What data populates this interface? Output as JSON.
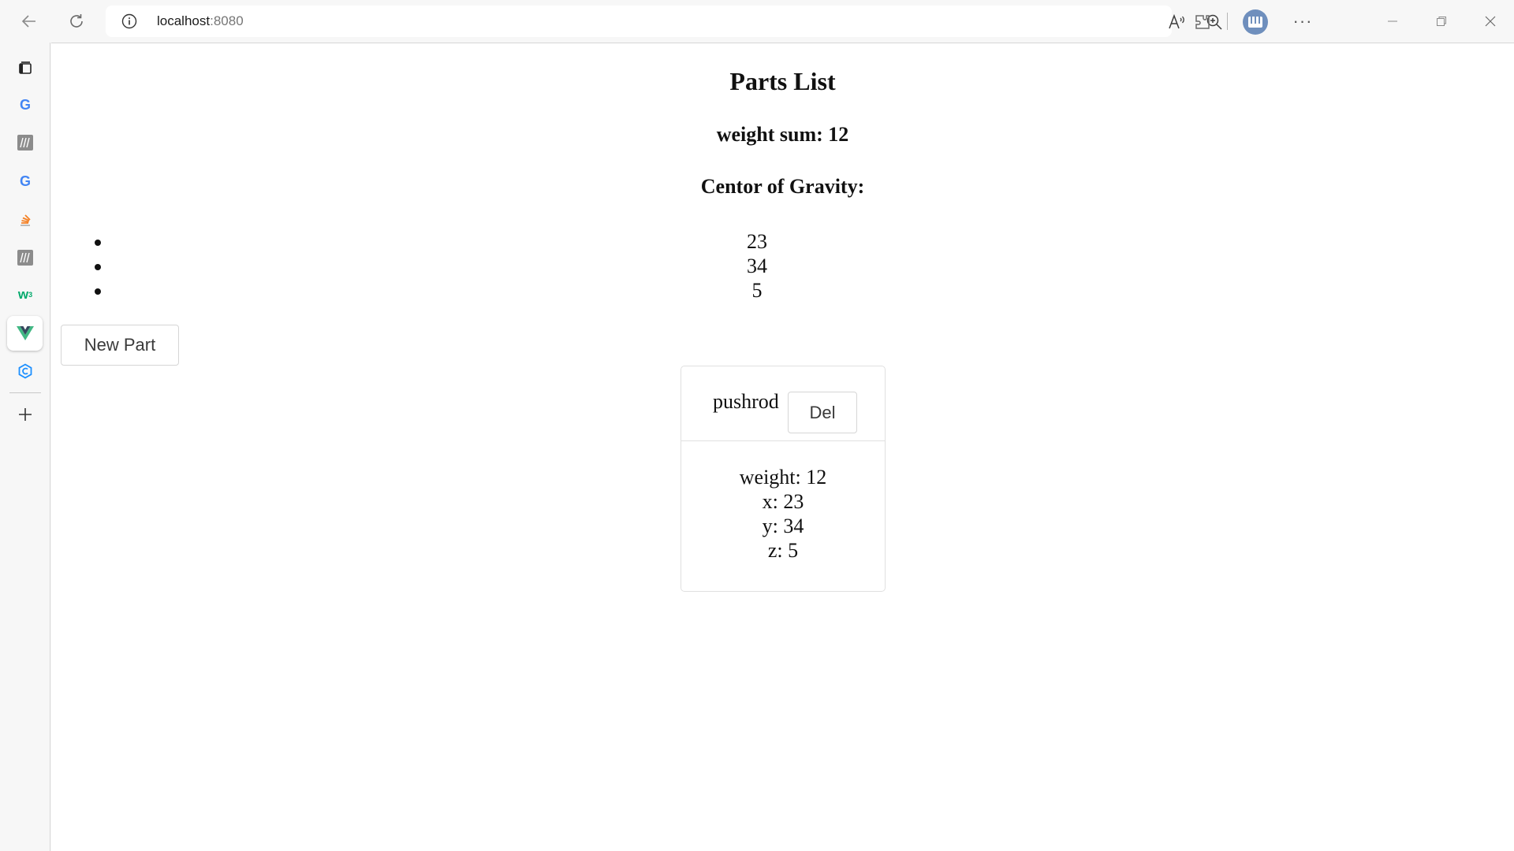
{
  "browser": {
    "url_host": "localhost",
    "url_port": ":8080"
  },
  "sidebar": {
    "items": [
      {
        "name": "tabs-icon"
      },
      {
        "name": "google-icon",
        "color": "#4285f4"
      },
      {
        "name": "m-icon",
        "color": "#7a7a7a"
      },
      {
        "name": "google-icon",
        "color": "#4285f4"
      },
      {
        "name": "stack-icon",
        "color": "#f48024"
      },
      {
        "name": "m-icon",
        "color": "#7a7a7a"
      },
      {
        "name": "w3-icon",
        "color": "#04aa6d"
      },
      {
        "name": "vue-icon",
        "color": "#41b883"
      },
      {
        "name": "hex-icon",
        "color": "#1e90ff"
      },
      {
        "name": "add-icon"
      }
    ]
  },
  "page": {
    "title": "Parts List",
    "weight_sum": "weight sum: 12",
    "cog_heading": "Centor of Gravity:",
    "cog_values": [
      "23",
      "34",
      "5"
    ],
    "new_part_label": "New Part"
  },
  "part": {
    "name": "pushrod",
    "del_label": "Del",
    "weight": "weight: 12",
    "x": "x: 23",
    "y": "y: 34",
    "z": "z: 5"
  }
}
